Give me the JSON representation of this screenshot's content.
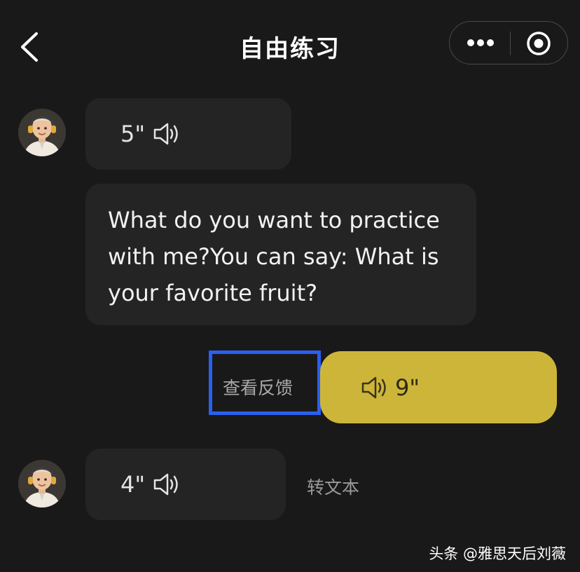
{
  "nav": {
    "title": "自由练习",
    "back_icon": "chevron-left-icon",
    "more_icon": "more-dots-icon",
    "close_icon": "target-close-icon"
  },
  "messages": [
    {
      "sender": "bot",
      "type": "voice",
      "duration": "5\"",
      "icon": "speaker-icon"
    },
    {
      "sender": "bot",
      "type": "text",
      "text": "What do you want to practice with me?You can say: What is your favorite fruit?"
    },
    {
      "sender": "user",
      "type": "voice",
      "duration": "9\"",
      "icon": "speaker-icon",
      "feedback_label": "查看反馈"
    },
    {
      "sender": "bot",
      "type": "voice",
      "duration": "4\"",
      "icon": "speaker-icon",
      "to_text_label": "转文本"
    }
  ],
  "watermark": "头条 @雅思天后刘薇",
  "colors": {
    "background": "#191919",
    "bubble": "#242424",
    "user_bubble": "#cdb53a",
    "highlight_box": "#2a5ff0"
  }
}
